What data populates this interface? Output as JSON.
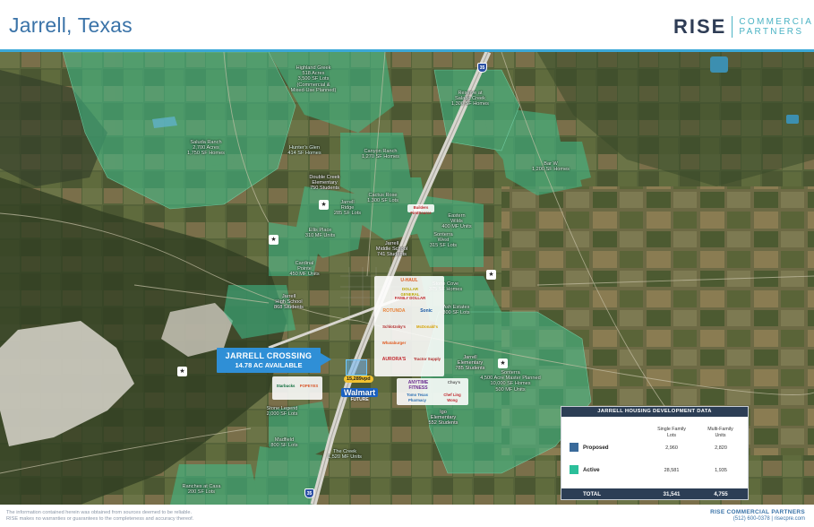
{
  "header": {
    "title": "Jarrell, Texas",
    "logo_brand": "RISE",
    "logo_line1": "COMMERCIAL",
    "logo_line2": "PARTNERS"
  },
  "map": {
    "callout": {
      "title": "JARRELL CROSSING",
      "subtitle": "14.78 AC AVAILABLE"
    },
    "highways": {
      "interstate": "35",
      "road_487": "487",
      "road_rcp": "RCP"
    },
    "traffic_counts": [
      "15,289vpd"
    ],
    "developments": [
      {
        "id": "highland",
        "text": "Highland Greek\n518 Acres\n3,500 SF Lots\n(Commercial &\nMixed-Use Planned)"
      },
      {
        "id": "saluda",
        "text": "Saluda Ranch\n2,700 Acres\n1,750 SF Homes"
      },
      {
        "id": "hunters",
        "text": "Hunter's Glen\n414 SF Homes"
      },
      {
        "id": "reserve",
        "text": "Reserve at\nSalado Creek\n1,300 SF Homes"
      },
      {
        "id": "canyon",
        "text": "Canyon Ranch\n1,270 SF Homes"
      },
      {
        "id": "bar",
        "text": "Bar W\n1,200 SF Homes"
      },
      {
        "id": "cactus",
        "text": "Cactus Rose\n1,300 SF Lots"
      },
      {
        "id": "jarrell-ridge",
        "text": "Jarrell\nRidge\n285 SF Lots"
      },
      {
        "id": "ellis",
        "text": "Ellis Place\n310 MF Units"
      },
      {
        "id": "eastern",
        "text": "Eastern\nWilds\n400 MF Units"
      },
      {
        "id": "crossing-tx",
        "text": "Sonterra\nWest\n315 SF Lots"
      },
      {
        "id": "cardinal",
        "text": "Cardinal\nPointe\n450 MF Units"
      },
      {
        "id": "stone-cove",
        "text": "Stone Cove\n375 SF Homes"
      },
      {
        "id": "ash-estates",
        "text": "Ash Estates\n300 SF Lots"
      },
      {
        "id": "sonterra",
        "text": "Sonterra\n4,500 Acre Master Planned\n10,000 SF Homes\n500 MF Units"
      },
      {
        "id": "stone-legend",
        "text": "Stone Legend\n2,000 SF Lots"
      },
      {
        "id": "madfield",
        "text": "Madfield\n800 SF Lots"
      },
      {
        "id": "the-creek",
        "text": "The Creek\n1,520 MF Units"
      },
      {
        "id": "ranches",
        "text": "Ranches at Casa\n200 SF Lots"
      }
    ],
    "schools": [
      {
        "id": "double-creek",
        "text": "Double Creek\nElementary\n750 Students"
      },
      {
        "id": "jarrell-middle",
        "text": "Jarrell\nMiddle School\n741 Students"
      },
      {
        "id": "jarrell-high",
        "text": "Jarrell\nHigh School\n868 Students"
      },
      {
        "id": "jarrell-elem",
        "text": "Jarrell\nElementary\n785 Students"
      },
      {
        "id": "igo-elem",
        "text": "Igo\nElementary\n552 Students"
      }
    ],
    "tenants": {
      "north": [
        "Builders FirstSource"
      ],
      "cluster_a": [
        "U-HAUL",
        "DOLLAR GENERAL",
        "FAMILY DOLLAR",
        "ROTUNDA",
        "Sonic",
        "Schlotzsky's",
        "McDonald's",
        "Whataburger",
        "AURORA'S",
        "Tractor Supply"
      ],
      "cluster_b": [
        "ANYTIME FITNESS",
        "Chef Ling Wong",
        "Tomo Texas Pharmacy",
        "Chuy's",
        "Starbucks",
        "POPEYES"
      ],
      "walmart_name": "Walmart",
      "walmart_sub": "FUTURE"
    }
  },
  "housing_table": {
    "title": "JARRELL HOUSING DEVELOPMENT DATA",
    "col1": "Single Family\nLots",
    "col2": "Multi-Family\nUnits",
    "rows": [
      {
        "label": "Proposed",
        "sf": "2,960",
        "mf": "2,820",
        "color": "#3a6a9a"
      },
      {
        "label": "Active",
        "sf": "28,581",
        "mf": "1,935",
        "color": "#2bbf9a"
      }
    ],
    "total": {
      "label": "TOTAL",
      "sf": "31,541",
      "mf": "4,755"
    }
  },
  "footer": {
    "disclaimer_1": "The information contained herein was obtained from sources deemed to be reliable.",
    "disclaimer_2": "RISE makes no warranties or guarantees to the completeness and accuracy thereof.",
    "brand": "RISE COMMERCIAL PARTNERS",
    "contact": "(512) 600-0378  |  risecpre.com"
  },
  "colors": {
    "accent_blue": "#3a73a8",
    "callout_blue": "#2f8fd6",
    "active_green": "#2bbf9a",
    "proposed_blue": "#3a6a9a",
    "navy": "#2c3e55"
  }
}
